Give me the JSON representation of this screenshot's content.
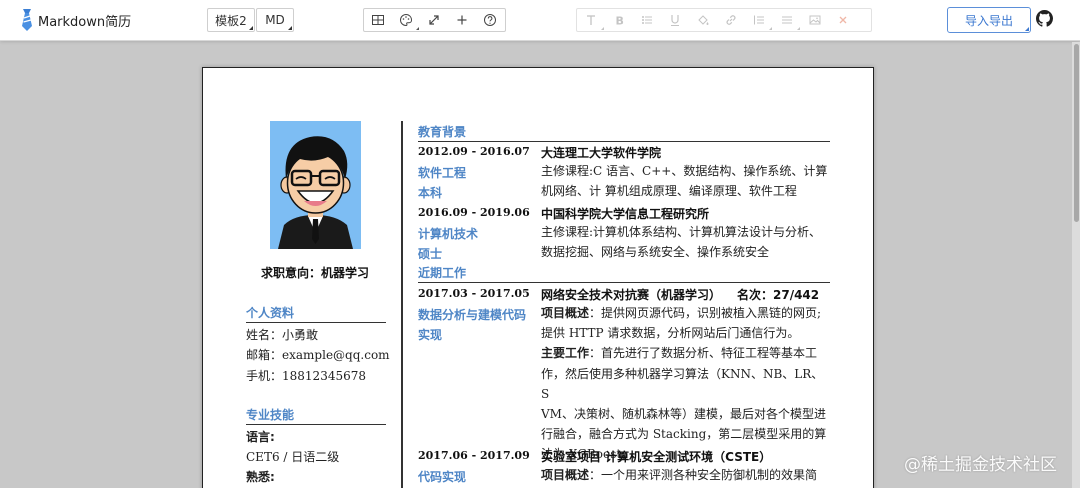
{
  "app": {
    "name": "Markdown简历"
  },
  "toolbar": {
    "template_label": "模板2",
    "mode_label": "MD",
    "export_label": "导入导出"
  },
  "icons": {
    "view_tools": [
      "table-icon",
      "palette-icon",
      "expand-icon",
      "plus-icon",
      "help-icon"
    ],
    "format_tools": [
      "text-icon",
      "bold-icon",
      "list-icon",
      "underline-icon",
      "color-fill-icon",
      "link-icon",
      "ordered-list-icon",
      "align-icon",
      "image-icon",
      "clear-icon"
    ]
  },
  "colors": {
    "accent": "#4f86c6",
    "export": "#3c78d0"
  },
  "resume": {
    "intent": "求职意向：机器学习",
    "profile": {
      "title": "个人资料",
      "name": "姓名：小勇敢",
      "email_label": "邮箱：",
      "email": "example@qq.com",
      "phone_label": "手机：",
      "phone": "18812345678"
    },
    "skills": {
      "title": "专业技能",
      "lang_label": "语言:",
      "lang_value": "CET6 / 日语二级",
      "familiar_label": "熟悉:"
    },
    "education": {
      "title": "教育背景",
      "items": [
        {
          "date": "2012.09 - 2016.07",
          "school": "大连理工大学软件学院",
          "major": "软件工程",
          "degree": "本科",
          "line1": "主修课程:C 语言、C++、数据结构、操作系统、计算",
          "line2": "机网络、计 算机组成原理、编译原理、软件工程"
        },
        {
          "date": "2016.09 - 2019.06",
          "school": "中国科学院大学信息工程研究所",
          "major": "计算机技术",
          "degree": "硕士",
          "line1": "主修课程:计算机体系结构、计算机算法设计与分析、",
          "line2": "数据挖掘、网络与系统安全、操作系统安全"
        }
      ]
    },
    "work": {
      "title": "近期工作",
      "items": [
        {
          "date": "2017.03 - 2017.05",
          "project": "网络安全技术对抗赛（机器学习）",
          "rank": "名次：27/442",
          "role1": "数据分析与建模代码",
          "role2": "实现",
          "overview_label": "项目概述",
          "overview_l1": "：提供网页源代码，识别被植入黑链的网页;",
          "overview_l2": "提供 HTTP 请求数据，分析网站后门通信行为。",
          "work_label": "主要工作",
          "work_l1": "：首先进行了数据分析、特征工程等基本工",
          "work_l2": "作，然后使用多种机器学习算法（KNN、NB、LR、S",
          "work_l3": "VM、决策树、随机森林等）建模，最后对各个模型进",
          "work_l4": "行融合，融合方式为 Stacking，第二层模型采用的算",
          "work_l5": "法为 XGBoost。"
        },
        {
          "date": "2017.06 - 2017.09",
          "project": "实验室项目 计算机安全测试环境（CSTE）",
          "role1": "代码实现",
          "overview_label": "项目概述",
          "overview_l1": "：一个用来评测各种安全防御机制的效果简"
        }
      ]
    }
  },
  "watermark": "@稀土掘金技术社区"
}
